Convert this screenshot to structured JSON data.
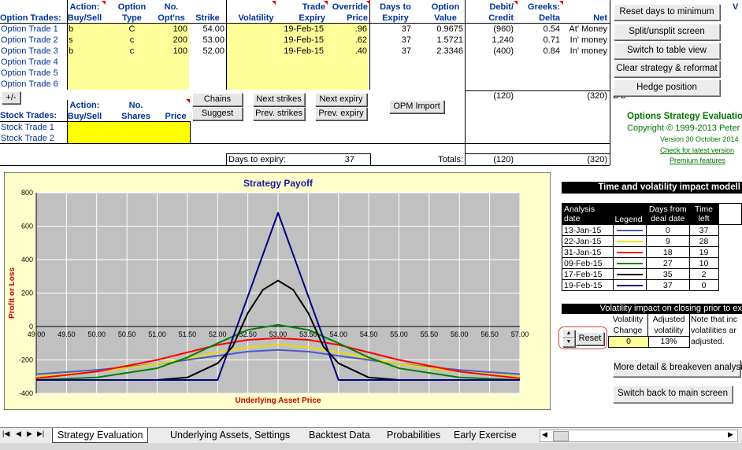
{
  "option_headers": {
    "row_label": "Option Trades:",
    "action": [
      "Action:",
      "Buy/Sell"
    ],
    "type": [
      "Option",
      "Type"
    ],
    "num": [
      "No.",
      "Opt'ns"
    ],
    "strike": "Strike",
    "volatility": "Volatility",
    "expiry": [
      "Trade",
      "Expiry"
    ],
    "override": [
      "Override",
      "Price"
    ],
    "days": [
      "Days to",
      "Expiry"
    ],
    "value": [
      "Option",
      "Value"
    ],
    "debit": [
      "Debit/",
      "Credit"
    ],
    "greeks": [
      "Greeks:",
      "Delta"
    ],
    "net": "Net"
  },
  "option_trades": [
    {
      "label": "Option Trade  1",
      "action": "b",
      "type": "C",
      "num": "100",
      "strike": "54.00",
      "expiry": "19-Feb-15",
      "override": ".96",
      "days": "37",
      "value": "0.9675",
      "debit": "(960)",
      "delta": "0.54",
      "net": "At' Money"
    },
    {
      "label": "Option Trade  2",
      "action": "s",
      "type": "c",
      "num": "200",
      "strike": "53.00",
      "expiry": "19-Feb-15",
      "override": ".62",
      "days": "37",
      "value": "1.5721",
      "debit": "1,240",
      "delta": "0.71",
      "net": "In' money"
    },
    {
      "label": "Option Trade  3",
      "action": "b",
      "type": "c",
      "num": "100",
      "strike": "52.00",
      "expiry": "19-Feb-15",
      "override": ".40",
      "days": "37",
      "value": "2.3346",
      "debit": "(400)",
      "delta": "0.84",
      "net": "In' money"
    },
    {
      "label": "Option Trade  4"
    },
    {
      "label": "Option Trade  5"
    },
    {
      "label": "Option Trade  6"
    }
  ],
  "subtotals": {
    "debit": "(120)",
    "net": "(320)",
    "extra": "D'b"
  },
  "plusminus": "+/-",
  "buttons": {
    "chains": "Chains",
    "suggest": "Suggest",
    "next_strikes": "Next strikes",
    "prev_strikes": "Prev. strikes",
    "next_expiry": "Next expiry",
    "prev_expiry": "Prev. expiry",
    "opm_import": "OPM Import",
    "reset": "Reset"
  },
  "stock_headers": {
    "row_label": "Stock Trades:",
    "action": [
      "Action:",
      "Buy/Sell"
    ],
    "shares": [
      "No.",
      "Shares"
    ],
    "price": "Price"
  },
  "stock_trades": [
    {
      "label": "Stock Trade 1"
    },
    {
      "label": "Stock Trade 2"
    }
  ],
  "totals_row": {
    "days_label": "Days to expiry:",
    "days_value": "37",
    "totals_label": "Totals:",
    "debit": "(120)",
    "net": "(320)"
  },
  "right_buttons": [
    "Reset days to minimum",
    "Split/unsplit screen",
    "Switch to table view",
    "Clear strategy & reformat",
    "Hedge position"
  ],
  "branding": {
    "title": "Options Strategy Evaluatio",
    "copyright": "Copyright © 1999-2013 Peter",
    "version": "Version 30 October 2014",
    "check": "Check for latest version",
    "premium": "Premium features"
  },
  "tv_panel": {
    "title": "Time and volatility impact modell",
    "headers": {
      "date": [
        "Analysis",
        "date"
      ],
      "legend": "Legend",
      "days": [
        "Days from",
        "deal date"
      ],
      "time": [
        "Time",
        "left"
      ]
    },
    "rows": [
      {
        "date": "13-Jan-15",
        "color": "#4a5ac8",
        "days": "0",
        "time": "37"
      },
      {
        "date": "22-Jan-15",
        "color": "#f0e000",
        "days": "9",
        "time": "28"
      },
      {
        "date": "31-Jan-15",
        "color": "#ff0000",
        "days": "18",
        "time": "19"
      },
      {
        "date": "09-Feb-15",
        "color": "#008000",
        "days": "27",
        "time": "10"
      },
      {
        "date": "17-Feb-15",
        "color": "#000000",
        "days": "35",
        "time": "2"
      },
      {
        "date": "19-Feb-15",
        "color": "#000080",
        "days": "37",
        "time": "0"
      }
    ]
  },
  "vol_panel": {
    "title": "Volatility impact on closing prior to ex",
    "change": [
      "Volatility",
      "Change"
    ],
    "adjusted": [
      "Adjusted",
      "volatility"
    ],
    "note": [
      "Note that inc",
      "volatilities ar",
      "adjusted."
    ],
    "change_value": "0",
    "adjusted_value": "13%"
  },
  "bottom_buttons": [
    "More detail & breakeven analysis",
    "Switch back to main screen"
  ],
  "tabs": [
    "Strategy Evaluation",
    "Underlying Assets, Settings",
    "Backtest Data",
    "Probabilities",
    "Early Exercise"
  ],
  "chart_data": {
    "type": "line",
    "title": "Strategy Payoff",
    "xlabel": "Underlying Asset Price",
    "ylabel": "Profit or Loss",
    "xlim": [
      49,
      57
    ],
    "ylim": [
      -400,
      800
    ],
    "x_ticks": [
      "49.00",
      "49.50",
      "50.00",
      "50.50",
      "51.00",
      "51.50",
      "52.00",
      "52.50",
      "53.00",
      "53.50",
      "54.00",
      "54.50",
      "55.00",
      "55.50",
      "56.00",
      "56.50",
      "57.00"
    ],
    "y_ticks": [
      "800",
      "600",
      "400",
      "200",
      "0",
      "-200",
      "-400"
    ],
    "series": [
      {
        "color": "#4a5ac8",
        "x": [
          49,
          50,
          51,
          51.5,
          52,
          52.5,
          53,
          53.5,
          54,
          54.5,
          55,
          56,
          57
        ],
        "y": [
          -285,
          -260,
          -225,
          -200,
          -175,
          -150,
          -140,
          -150,
          -175,
          -200,
          -225,
          -260,
          -285
        ]
      },
      {
        "color": "#e8dc00",
        "x": [
          49,
          50,
          51,
          51.5,
          52,
          52.5,
          53,
          53.5,
          54,
          54.5,
          55,
          56,
          57
        ],
        "y": [
          -300,
          -270,
          -225,
          -190,
          -155,
          -125,
          -110,
          -125,
          -155,
          -190,
          -225,
          -270,
          -300
        ]
      },
      {
        "color": "#ff0000",
        "x": [
          49,
          50,
          51,
          51.5,
          52,
          52.5,
          53,
          53.5,
          54,
          54.5,
          55,
          56,
          57
        ],
        "y": [
          -310,
          -270,
          -200,
          -155,
          -110,
          -80,
          -70,
          -80,
          -110,
          -155,
          -200,
          -270,
          -310
        ]
      },
      {
        "color": "#008000",
        "x": [
          49,
          50,
          51,
          51.5,
          52,
          52.5,
          53,
          53.5,
          54,
          54.5,
          55,
          56,
          57
        ],
        "y": [
          -320,
          -305,
          -250,
          -185,
          -100,
          -20,
          10,
          -20,
          -100,
          -185,
          -250,
          -305,
          -320
        ]
      },
      {
        "color": "#000000",
        "x": [
          49,
          50,
          51,
          51.5,
          52,
          52.25,
          52.5,
          52.75,
          53,
          53.25,
          53.5,
          53.75,
          54,
          54.5,
          55,
          56,
          57
        ],
        "y": [
          -320,
          -320,
          -320,
          -305,
          -220,
          -120,
          80,
          220,
          275,
          220,
          80,
          -120,
          -220,
          -305,
          -320,
          -320,
          -320
        ]
      },
      {
        "color": "#000080",
        "x": [
          49,
          52,
          53,
          54,
          57
        ],
        "y": [
          -320,
          -320,
          680,
          -320,
          -320
        ]
      }
    ]
  }
}
